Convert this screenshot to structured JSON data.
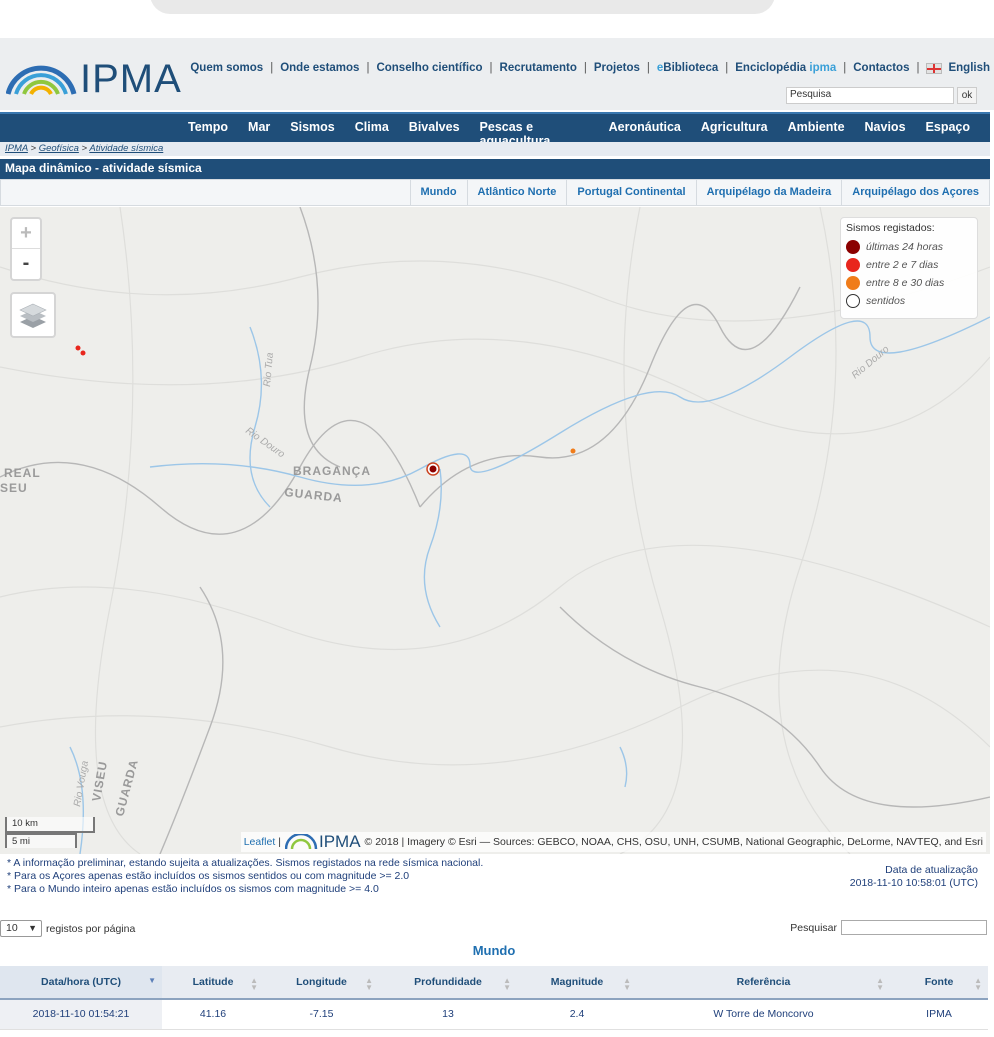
{
  "header": {
    "logo_text": "IPMA",
    "links": [
      "Quem somos",
      "Onde estamos",
      "Conselho científico",
      "Recrutamento",
      "Projetos"
    ],
    "ebiblioteca_prefix": "e",
    "ebiblioteca_label": "Biblioteca",
    "enciclopedia_label": "Enciclopédia",
    "enciclopedia_accent": "ipma",
    "contactos_label": "Contactos",
    "language_label": "English",
    "search_value": "Pesquisa",
    "search_button": "ok"
  },
  "nav": [
    "Tempo",
    "Mar",
    "Sismos",
    "Clima",
    "Bivalves",
    "Pescas e aquacultura",
    "Aeronáutica",
    "Agricultura",
    "Ambiente",
    "Navios",
    "Espaço"
  ],
  "breadcrumb": [
    "IPMA",
    "Geofísica",
    "Atividade sísmica"
  ],
  "breadcrumb_sep": ">",
  "page_title": "Mapa dinâmico - atividade sísmica",
  "region_tabs": [
    "Mundo",
    "Atlântico Norte",
    "Portugal Continental",
    "Arquipélago da Madeira",
    "Arquipélago dos Açores"
  ],
  "map": {
    "zoom_in": "+",
    "zoom_out": "-",
    "labels": {
      "rio_tua": "Rio Tua",
      "rio_douro_1": "Rio Douro",
      "rio_douro_2": "Rio Douro",
      "braganca": "BRAGANÇA",
      "guarda_1": "GUARDA",
      "real": "REAL",
      "seu": "SEU",
      "rio_vouga": "Rio Vouga",
      "viseu": "VISEU",
      "guarda_2": "GUARDA"
    },
    "legend": {
      "title": "Sismos registados:",
      "items": [
        {
          "label": "últimas 24 horas",
          "color": "#8b0000"
        },
        {
          "label": "entre 2 e 7 dias",
          "color": "#e8261d"
        },
        {
          "label": "entre 8 e 30 dias",
          "color": "#f07c1a"
        },
        {
          "label": "sentidos",
          "color": "#ffffff"
        }
      ]
    },
    "scale_km": "10 km",
    "scale_mi": "5 mi",
    "attribution_leaflet": "Leaflet",
    "attribution_sep": "|",
    "attribution_logo": "IPMA",
    "attribution_text": "© 2018 | Imagery © Esri — Sources: GEBCO, NOAA, CHS, OSU, UNH, CSUMB, National Geographic, DeLorme, NAVTEQ, and Esri"
  },
  "notes": [
    "* A informação preliminar, estando sujeita a atualizações. Sismos registados na rede sísmica nacional.",
    "* Para os Açores apenas estão incluídos os sismos sentidos ou com magnitude >= 2.0",
    "* Para o Mundo inteiro apenas estão incluídos os sismos com magnitude >= 4.0"
  ],
  "update": {
    "label": "Data de atualização",
    "value": "2018-11-10 10:58:01 (UTC)"
  },
  "table": {
    "per_page_value": "10",
    "per_page_label": "registos por página",
    "search_label": "Pesquisar",
    "title": "Mundo",
    "columns": [
      "Data/hora (UTC)",
      "Latitude",
      "Longitude",
      "Profundidade",
      "Magnitude",
      "Referência",
      "Fonte"
    ],
    "rows": [
      [
        "2018-11-10 01:54:21",
        "41.16",
        "-7.15",
        "13",
        "2.4",
        "W Torre de Moncorvo",
        "IPMA"
      ]
    ]
  }
}
